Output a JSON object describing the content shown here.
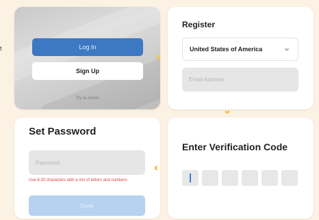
{
  "edge_text": "t",
  "login": {
    "login_label": "Log In",
    "signup_label": "Sign Up",
    "guest_label": "Try as Guest"
  },
  "register": {
    "title": "Register",
    "country_value": "United States of America",
    "email_placeholder": "Email Address"
  },
  "password": {
    "title": "Set Password",
    "field_placeholder": "Password",
    "hint_text": "Use 6-20 characters with a mix of letters and numbers",
    "done_label": "Done"
  },
  "verify": {
    "title": "Enter Verification Code",
    "code_box_count": 6
  },
  "arrows": {
    "right": "›››",
    "down": "›››",
    "left": "‹‹‹"
  },
  "colors": {
    "background": "#fcf2e4",
    "primary": "#3d79c2",
    "arrow": "#f2c24e",
    "error": "#e03c3c"
  }
}
